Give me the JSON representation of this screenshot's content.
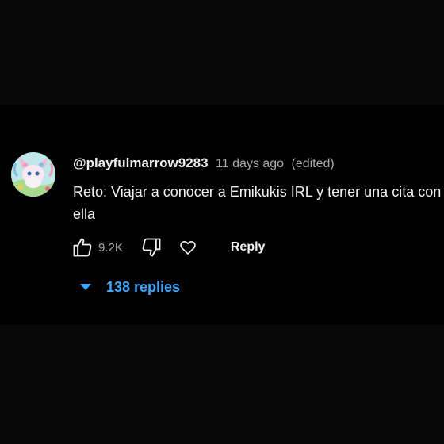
{
  "comment": {
    "author": "@playfulmarrow9283",
    "time": "11 days ago",
    "edited": "(edited)",
    "text": "Reto: Viajar a conocer a Emikukis IRL y tener una cita con ella",
    "like_count": "9.2K",
    "reply_label": "Reply",
    "replies_label": "138 replies"
  },
  "icons": {
    "like": "thumbs-up-icon",
    "dislike": "thumbs-down-icon",
    "heart": "heart-icon",
    "expand": "caret-down-icon"
  },
  "colors": {
    "background": "#000000",
    "primary_text": "#f1f1f1",
    "secondary_text": "#aaaaaa",
    "link": "#3ea6ff"
  }
}
